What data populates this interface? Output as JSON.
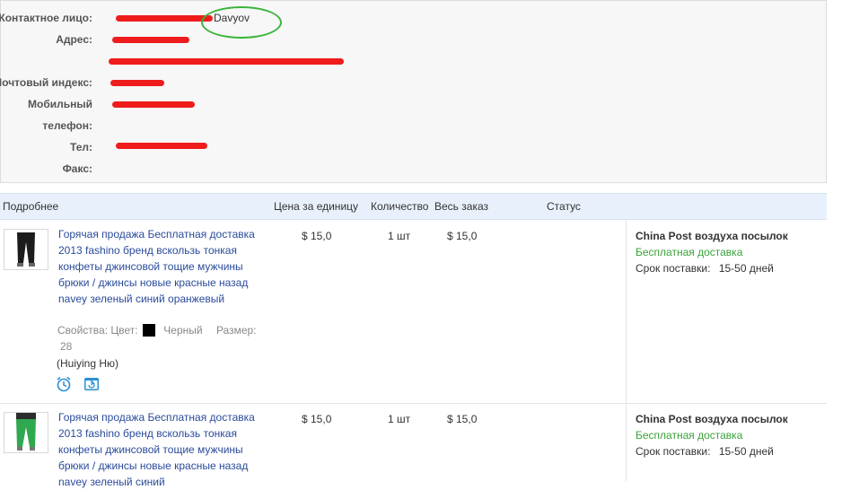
{
  "contact": {
    "contact_person_label": "Контактное лицо:",
    "contact_person_value": "Davyov",
    "address_label": "Адрес:",
    "postal_label": "Почтовый индекс:",
    "mobile_label": "Мобильный",
    "phone_label": "телефон:",
    "tel_label": "Тел:",
    "fax_label": "Факс:"
  },
  "table": {
    "col_details": "Подробнее",
    "col_unit_price": "Цена за единицу",
    "col_quantity": "Количество",
    "col_total": "Весь заказ",
    "col_status": "Статус"
  },
  "rows": [
    {
      "title": "Горячая продажа Бесплатная доставка 2013 fashino бренд вскользь тонкая конфеты джинсовой тощие мужчины брюки / джинсы новые красные назад navey зеленый синий оранжевый",
      "props_label": "Свойства: Цвет:",
      "color_name": "Черный",
      "size_label": "Размер:",
      "size_value": "28",
      "seller": "(Huiying Ню)",
      "unit_price": "$ 15,0",
      "quantity": "1 шт",
      "total": "$ 15,0",
      "shipping_method": "China Post воздуха посылок",
      "shipping_free": "Бесплатная доставка",
      "delivery_label": "Срок поставки:",
      "delivery_value": "15-50 дней"
    },
    {
      "title": "Горячая продажа Бесплатная доставка 2013 fashino бренд вскользь тонкая конфеты джинсовой тощие мужчины брюки / джинсы новые красные назад navey зеленый синий",
      "unit_price": "$ 15,0",
      "quantity": "1 шт",
      "total": "$ 15,0",
      "shipping_method": "China Post воздуха посылок",
      "shipping_free": "Бесплатная доставка",
      "delivery_label": "Срок поставки:",
      "delivery_value": "15-50 дней"
    }
  ],
  "colors": {
    "link": "#2a4b9b",
    "free_shipping": "#3aa33a",
    "redaction": "#ef1c1c",
    "highlight_circle": "#3bb43b",
    "header_bg": "#e8f1fb"
  },
  "icons": [
    "alarm-clock-icon",
    "refresh-icon"
  ]
}
